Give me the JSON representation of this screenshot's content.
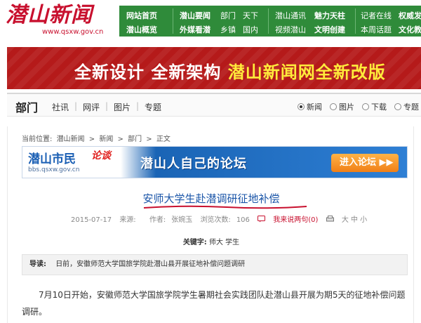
{
  "site": {
    "logo": "潜山新闻",
    "logo_url": "www.qsxw.gov.cn"
  },
  "topnav": {
    "row1": [
      "网站首页",
      "潜山要闻",
      "部门",
      "天下",
      "潜山通讯",
      "魅力天柱",
      "记者在线",
      "权威发"
    ],
    "row2": [
      "潜山概览",
      "外媒看潜",
      "乡镇",
      "国内",
      "视频潜山",
      "文明创建",
      "本周话题",
      "文化教"
    ]
  },
  "banner": {
    "text_a": "全新设计  全新架构  ",
    "text_b": "潜山新闻网全新改版"
  },
  "section": {
    "title": "部门",
    "links": [
      "社讯",
      "网评",
      "图片",
      "专题"
    ],
    "search_options": [
      "新闻",
      "图片",
      "下载",
      "专题"
    ],
    "search_selected": "新闻"
  },
  "breadcrumb": {
    "label": "当前位置:",
    "items": [
      "潜山新闻",
      "新闻",
      "部门",
      "正文"
    ]
  },
  "forum_ad": {
    "brand": "潜山市民",
    "tag": "论谈",
    "url": "bbs.qsxw.gov.cn",
    "slogan": "潜山人自己的论坛",
    "button": "进入论坛 ▶▶"
  },
  "article": {
    "title": "安师大学生赴潜调研征地补偿",
    "date": "2015-07-17",
    "source_label": "来源:",
    "source": "",
    "author_label": "作者:",
    "author": "张婉玉",
    "views_label": "浏览次数:",
    "views": "106",
    "report": "我来说两句(0)",
    "font_size": "大 中 小",
    "keywords_label": "关键字:",
    "keywords": "师大  学生",
    "lead_label": "导读:",
    "lead": "日前，安徽师范大学国旅学院赴潜山县开展征地补偿问题调研",
    "body": "7月10日开始，安徽师范大学国旅学院学生暑期社会实践团队赴潜山县开展为期5天的征地补偿问题调研。"
  },
  "colors": {
    "brand_red": "#c8102e",
    "nav_green": "#2f8b3a",
    "headline_blue": "#1a55a8",
    "banner_red": "#b51a1a"
  }
}
